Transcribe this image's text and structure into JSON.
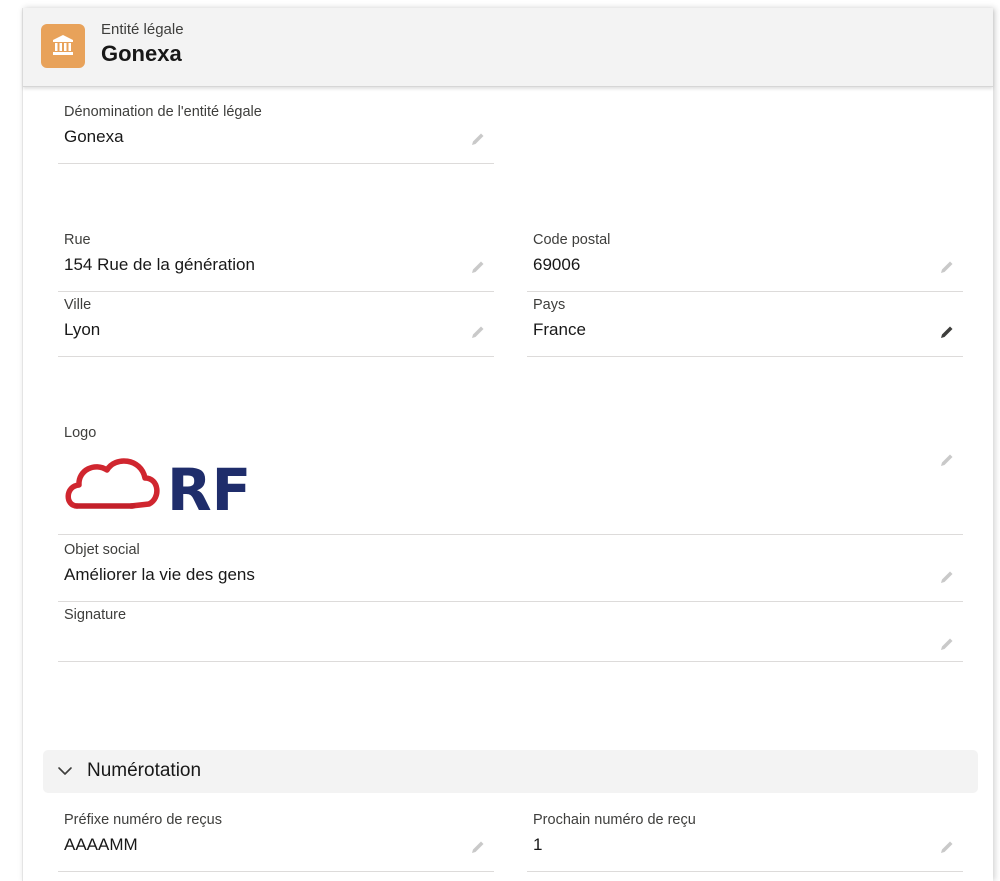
{
  "header": {
    "object_type": "Entité légale",
    "record_name": "Gonexa",
    "icon": "bank-icon",
    "icon_color": "#e8a25a"
  },
  "fields": {
    "legal_name": {
      "label": "Dénomination de l'entité légale",
      "value": "Gonexa"
    },
    "street": {
      "label": "Rue",
      "value": "154 Rue de la génération"
    },
    "postal_code": {
      "label": "Code postal",
      "value": "69006"
    },
    "city": {
      "label": "Ville",
      "value": "Lyon"
    },
    "country": {
      "label": "Pays",
      "value": "France"
    },
    "logo": {
      "label": "Logo",
      "image_text": "RF",
      "cloud_color": "#d0262f",
      "text_color": "#1f2d6b"
    },
    "social_object": {
      "label": "Objet social",
      "value": "Améliorer la vie des gens"
    },
    "signature": {
      "label": "Signature",
      "value": ""
    }
  },
  "section_numbering": {
    "title": "Numérotation",
    "icon": "chevron-down-icon",
    "fields": {
      "receipt_prefix": {
        "label": "Préfixe numéro de reçus",
        "value": "AAAAMM"
      },
      "next_receipt_number": {
        "label": "Prochain numéro de reçu",
        "value": "1"
      }
    }
  },
  "colors": {
    "header_bg": "#f3f3f3",
    "pencil_light": "#c9c9c9",
    "pencil_dark": "#3e3e3c"
  }
}
